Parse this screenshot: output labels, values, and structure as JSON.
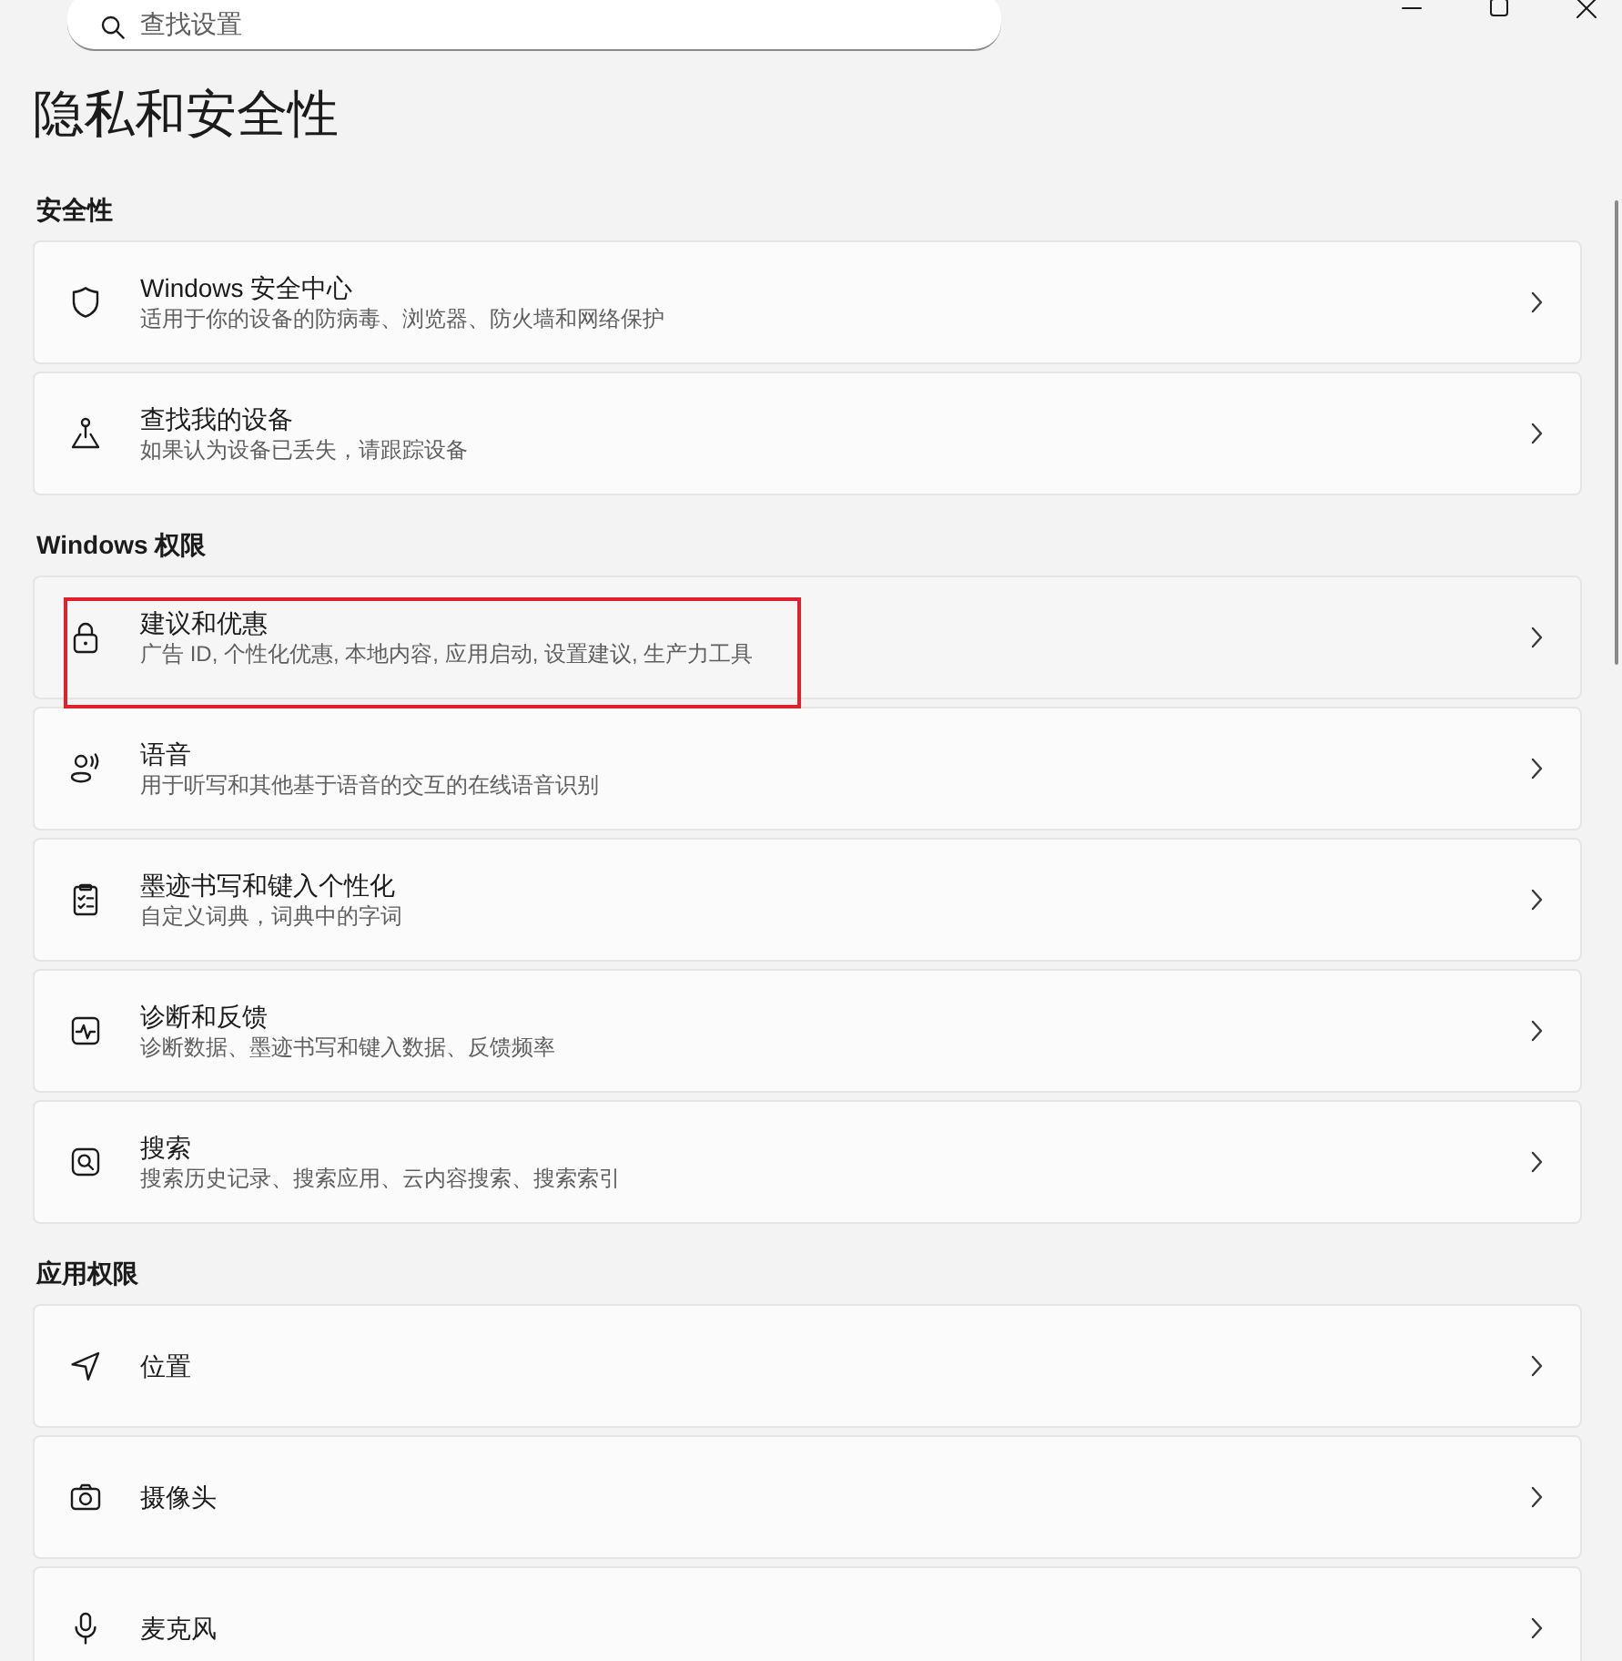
{
  "search": {
    "placeholder": "查找设置"
  },
  "page_title": "隐私和安全性",
  "sections": [
    {
      "heading": "安全性",
      "items": [
        {
          "title": "Windows 安全中心",
          "subtitle": "适用于你的设备的防病毒、浏览器、防火墙和网络保护",
          "highlighted": false,
          "outlined": false
        },
        {
          "title": "查找我的设备",
          "subtitle": "如果认为设备已丢失，请跟踪设备",
          "highlighted": false,
          "outlined": false
        }
      ]
    },
    {
      "heading": "Windows 权限",
      "items": [
        {
          "title": "建议和优惠",
          "subtitle": "广告 ID, 个性化优惠, 本地内容, 应用启动, 设置建议, 生产力工具",
          "highlighted": true,
          "outlined": true
        },
        {
          "title": "语音",
          "subtitle": "用于听写和其他基于语音的交互的在线语音识别",
          "highlighted": false,
          "outlined": false
        },
        {
          "title": "墨迹书写和键入个性化",
          "subtitle": "自定义词典，词典中的字词",
          "highlighted": false,
          "outlined": false
        },
        {
          "title": "诊断和反馈",
          "subtitle": "诊断数据、墨迹书写和键入数据、反馈频率",
          "highlighted": false,
          "outlined": false
        },
        {
          "title": "搜索",
          "subtitle": "搜索历史记录、搜索应用、云内容搜索、搜索索引",
          "highlighted": false,
          "outlined": false
        }
      ]
    },
    {
      "heading": "应用权限",
      "items": [
        {
          "title": "位置",
          "highlighted": false,
          "outlined": false
        },
        {
          "title": "摄像头",
          "highlighted": false,
          "outlined": false
        },
        {
          "title": "麦克风",
          "highlighted": false,
          "outlined": false
        }
      ]
    }
  ]
}
